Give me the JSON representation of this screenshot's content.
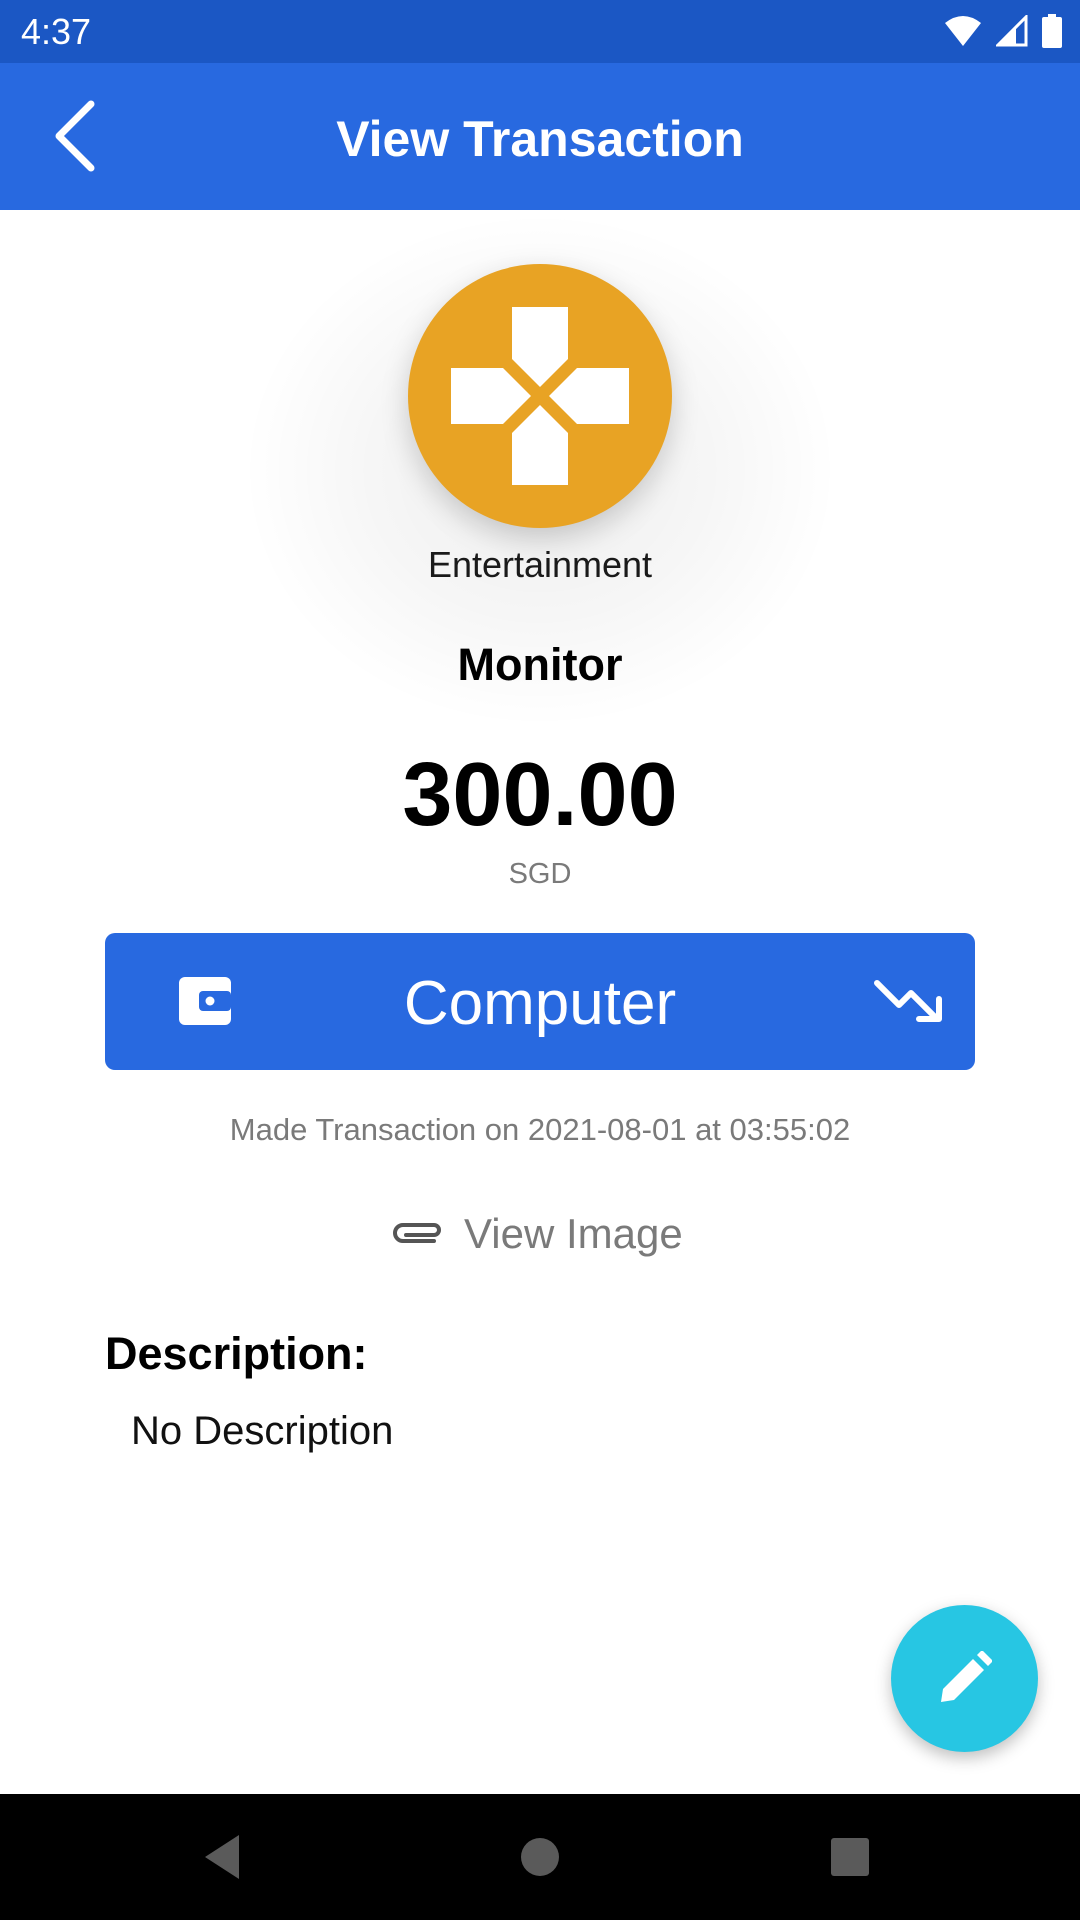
{
  "status_bar": {
    "time": "4:37",
    "icons": [
      "wifi-icon",
      "cell-signal-icon",
      "battery-icon"
    ]
  },
  "app_bar": {
    "title": "View Transaction",
    "back_icon": "chevron-left-icon",
    "background": "#2869e0"
  },
  "transaction": {
    "category": "Entertainment",
    "category_icon": "gamepad-icon",
    "category_color": "#e8a324",
    "name": "Monitor",
    "amount": "300.00",
    "currency": "SGD",
    "account": "Computer",
    "account_icon": "wallet-icon",
    "type_icon": "trending-down-icon",
    "made_on": "Made Transaction on 2021-08-01 at 03:55:02",
    "attachment_label": "View Image",
    "attachment_icon": "paperclip-icon",
    "description_title": "Description:",
    "description": "No Description"
  },
  "fab": {
    "icon": "pencil-icon",
    "color": "#27c6e3"
  },
  "nav_bar": {
    "icons": [
      "nav-back-icon",
      "nav-home-icon",
      "nav-recents-icon"
    ]
  }
}
